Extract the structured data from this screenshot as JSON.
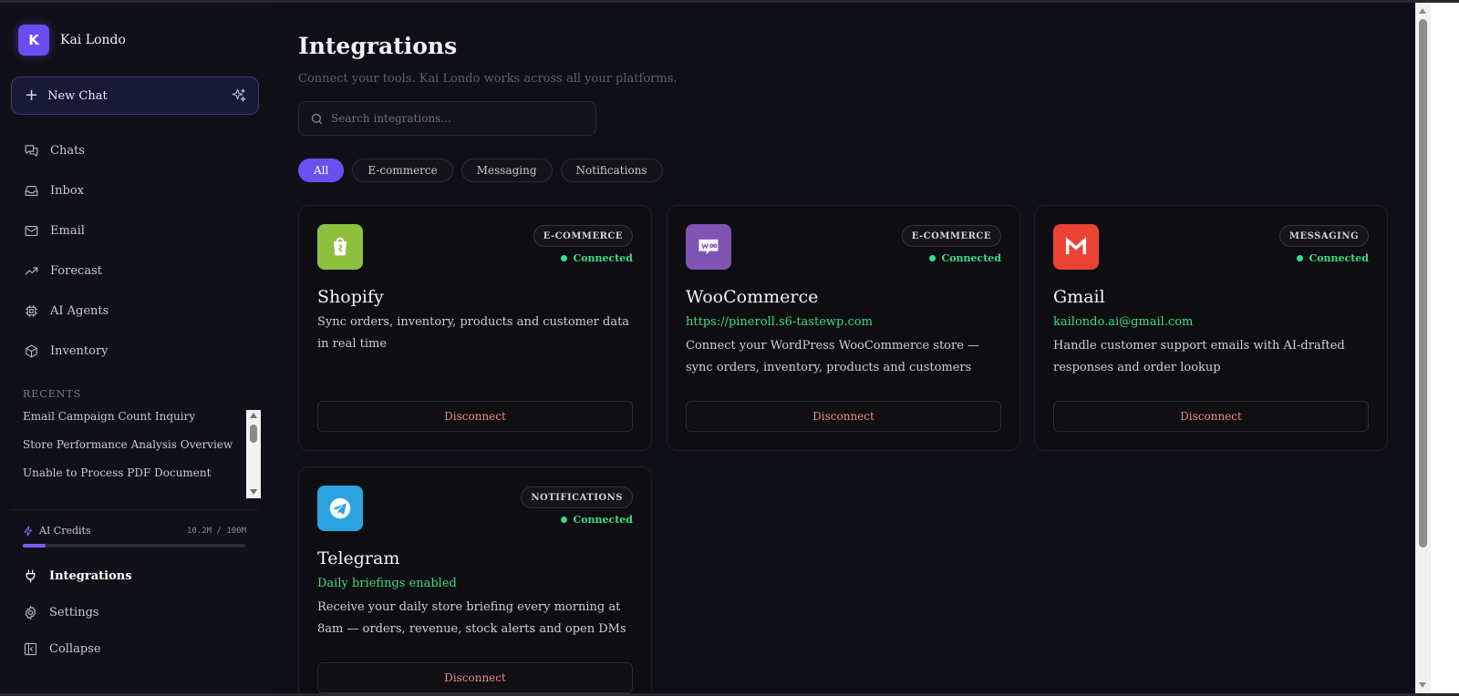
{
  "brand": {
    "initial": "K",
    "name": "Kai Londo"
  },
  "new_chat": {
    "label": "New Chat"
  },
  "nav": [
    {
      "label": "Chats",
      "icon": "chats-icon"
    },
    {
      "label": "Inbox",
      "icon": "inbox-icon"
    },
    {
      "label": "Email",
      "icon": "mail-icon"
    },
    {
      "label": "Forecast",
      "icon": "trend-icon"
    },
    {
      "label": "AI Agents",
      "icon": "chip-icon"
    },
    {
      "label": "Inventory",
      "icon": "box-icon"
    }
  ],
  "recents": {
    "title": "RECENTS",
    "items": [
      "Email Campaign Count Inquiry",
      "Store Performance Analysis Overview",
      "Unable to Process PDF Document"
    ]
  },
  "credits": {
    "label": "AI Credits",
    "value": "10.2M / 100M",
    "fraction": 0.102
  },
  "bottom_nav": [
    {
      "label": "Integrations",
      "icon": "plug-icon"
    },
    {
      "label": "Settings",
      "icon": "gear-icon"
    },
    {
      "label": "Collapse",
      "icon": "collapse-icon"
    }
  ],
  "page": {
    "title": "Integrations",
    "subtitle": "Connect your tools. Kai Londo works across all your platforms.",
    "search_placeholder": "Search integrations..."
  },
  "filters": [
    "All",
    "E-commerce",
    "Messaging",
    "Notifications"
  ],
  "colors": {
    "accent": "#6b4ff0",
    "connected": "#3ddc84",
    "disconnect": "#f08a8a",
    "shopify": "#8fbf3f",
    "woocommerce": "#7f54b3",
    "gmail": "#ea4335",
    "telegram": "#2aa3e0"
  },
  "cards": [
    {
      "name": "Shopify",
      "category": "E-COMMERCE",
      "status": "Connected",
      "subtitle": "",
      "description": "Sync orders, inventory, products and customer data in real time",
      "action": "Disconnect",
      "icon": "shopify-icon"
    },
    {
      "name": "WooCommerce",
      "category": "E-COMMERCE",
      "status": "Connected",
      "subtitle": "https://pineroll.s6-tastewp.com",
      "description": "Connect your WordPress WooCommerce store — sync orders, inventory, products and customers",
      "action": "Disconnect",
      "icon": "woocommerce-icon"
    },
    {
      "name": "Gmail",
      "category": "MESSAGING",
      "status": "Connected",
      "subtitle": "kailondo.ai@gmail.com",
      "description": "Handle customer support emails with AI-drafted responses and order lookup",
      "action": "Disconnect",
      "icon": "gmail-icon"
    },
    {
      "name": "Telegram",
      "category": "NOTIFICATIONS",
      "status": "Connected",
      "subtitle": "Daily briefings enabled",
      "description": "Receive your daily store briefing every morning at 8am — orders, revenue, stock alerts and open DMs",
      "action": "Disconnect",
      "icon": "telegram-icon"
    }
  ]
}
